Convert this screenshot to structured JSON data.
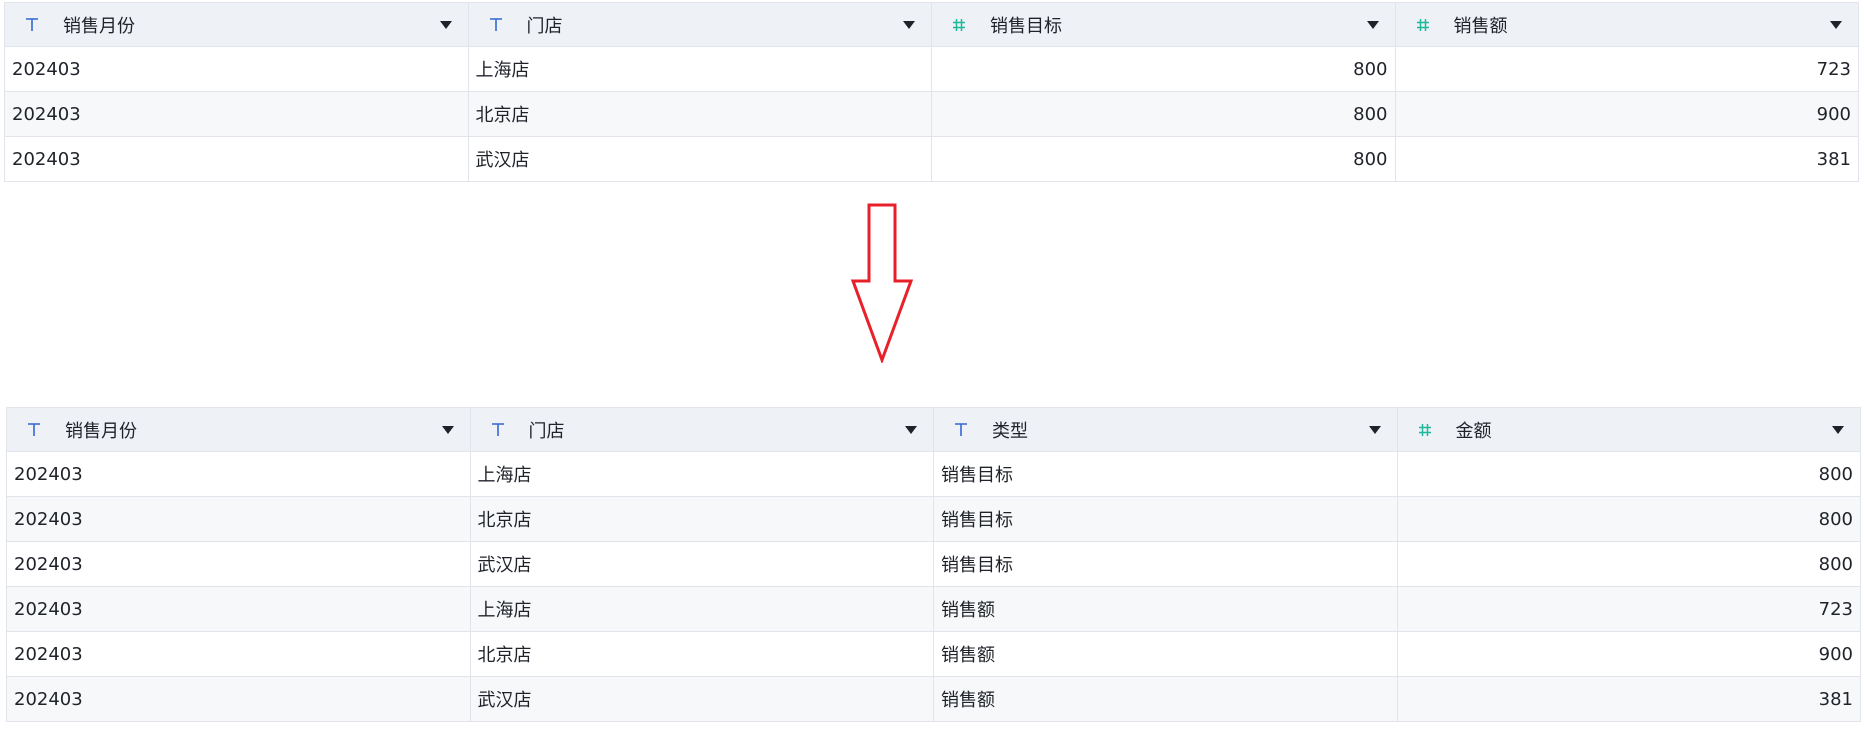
{
  "accent_colors": {
    "text_type_icon": "#3366d6",
    "number_type_icon": "#1fb89a",
    "arrow": "#e8202a",
    "header_bg": "#eef1f6",
    "stripe_bg": "#f7f8fa"
  },
  "source_table": {
    "columns": [
      {
        "label": "销售月份",
        "type_icon": "text-type-icon"
      },
      {
        "label": "门店",
        "type_icon": "text-type-icon"
      },
      {
        "label": "销售目标",
        "type_icon": "number-type-icon"
      },
      {
        "label": "销售额",
        "type_icon": "number-type-icon"
      }
    ],
    "rows": [
      [
        "202403",
        "上海店",
        "800",
        "723"
      ],
      [
        "202403",
        "北京店",
        "800",
        "900"
      ],
      [
        "202403",
        "武汉店",
        "800",
        "381"
      ]
    ]
  },
  "result_table": {
    "columns": [
      {
        "label": "销售月份",
        "type_icon": "text-type-icon"
      },
      {
        "label": "门店",
        "type_icon": "text-type-icon"
      },
      {
        "label": "类型",
        "type_icon": "text-type-icon"
      },
      {
        "label": "金额",
        "type_icon": "number-type-icon"
      }
    ],
    "rows": [
      [
        "202403",
        "上海店",
        "销售目标",
        "800"
      ],
      [
        "202403",
        "北京店",
        "销售目标",
        "800"
      ],
      [
        "202403",
        "武汉店",
        "销售目标",
        "800"
      ],
      [
        "202403",
        "上海店",
        "销售额",
        "723"
      ],
      [
        "202403",
        "北京店",
        "销售额",
        "900"
      ],
      [
        "202403",
        "武汉店",
        "销售额",
        "381"
      ]
    ]
  },
  "transform_arrow_icon": "down-arrow-icon"
}
